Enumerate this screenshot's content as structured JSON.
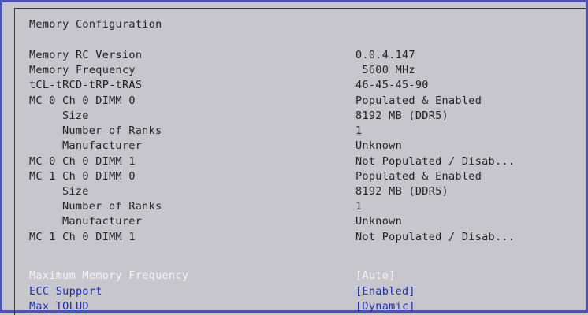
{
  "page_title": "Memory Configuration",
  "info": [
    {
      "label": "Memory RC Version",
      "value": "0.0.4.147",
      "indent": false
    },
    {
      "label": "Memory Frequency",
      "value": " 5600 MHz",
      "indent": false
    },
    {
      "label": "tCL-tRCD-tRP-tRAS",
      "value": "46-45-45-90",
      "indent": false
    },
    {
      "label": "MC 0 Ch 0 DIMM 0",
      "value": "Populated & Enabled",
      "indent": false
    },
    {
      "label": "Size",
      "value": "8192 MB (DDR5)",
      "indent": true
    },
    {
      "label": "Number of Ranks",
      "value": "1",
      "indent": true
    },
    {
      "label": "Manufacturer",
      "value": "Unknown",
      "indent": true
    },
    {
      "label": "MC 0 Ch 0 DIMM 1",
      "value": "Not Populated / Disab...",
      "indent": false
    },
    {
      "label": "MC 1 Ch 0 DIMM 0",
      "value": "Populated & Enabled",
      "indent": false
    },
    {
      "label": "Size",
      "value": "8192 MB (DDR5)",
      "indent": true
    },
    {
      "label": "Number of Ranks",
      "value": "1",
      "indent": true
    },
    {
      "label": "Manufacturer",
      "value": "Unknown",
      "indent": true
    },
    {
      "label": "MC 1 Ch 0 DIMM 1",
      "value": "Not Populated / Disab...",
      "indent": false
    }
  ],
  "options": [
    {
      "label": "Maximum Memory Frequency",
      "value": "[Auto]",
      "selected": true
    },
    {
      "label": "ECC Support",
      "value": "[Enabled]",
      "selected": false
    },
    {
      "label": "Max TOLUD",
      "value": "[Dynamic]",
      "selected": false
    }
  ],
  "colors": {
    "background": "#c6c6cc",
    "border": "#4e52a8",
    "text": "#232323",
    "option_text": "#1f2fb0",
    "selected_text": "#f4f4f4"
  }
}
